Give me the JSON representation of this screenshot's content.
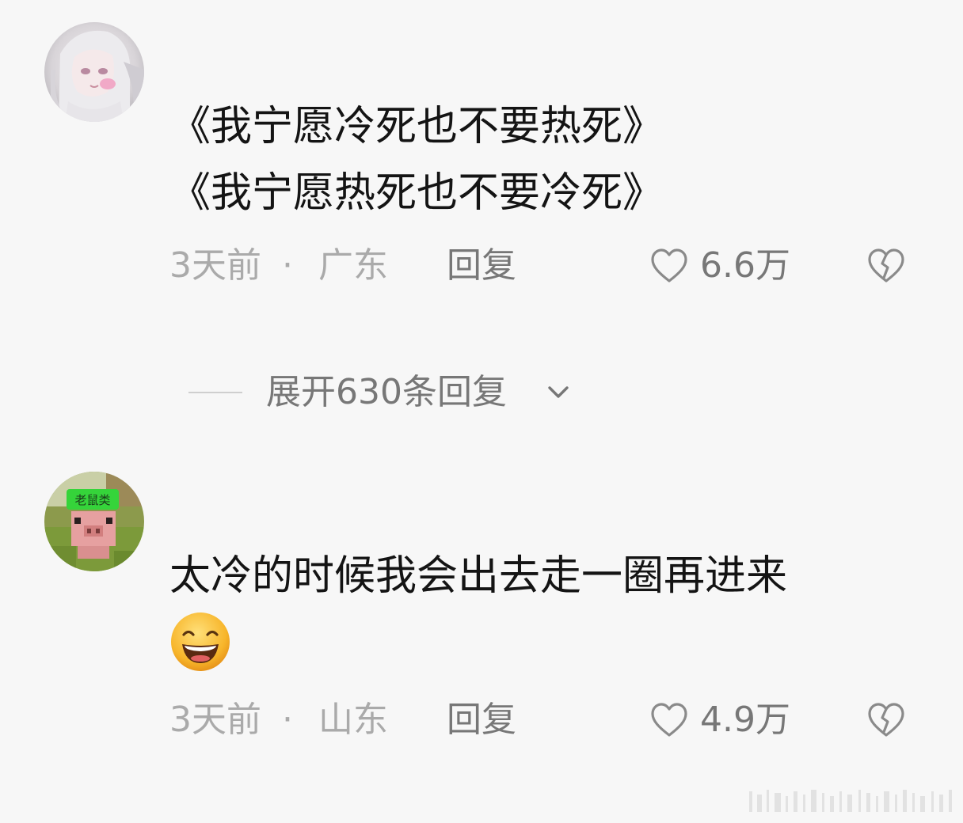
{
  "comments": [
    {
      "avatar_icon": "anime-girl-avatar",
      "text_lines": [
        "《我宁愿冷死也不要热死》",
        "《我宁愿热死也不要冷死》"
      ],
      "time": "3天前",
      "separator": "·",
      "location": "广东",
      "reply_label": "回复",
      "like_count": "6.6万"
    },
    {
      "avatar_icon": "pixel-pig-avatar",
      "avatar_badge": "老鼠类",
      "text_lines": [
        "太冷的时候我会出去走一圈再进来"
      ],
      "emoji": "grinning-squinting-face-emoji",
      "time": "3天前",
      "separator": "·",
      "location": "山东",
      "reply_label": "回复",
      "like_count": "4.9万"
    }
  ],
  "expand_replies": {
    "label": "展开630条回复"
  },
  "colors": {
    "background": "#f7f7f7",
    "text_primary": "#141414",
    "text_meta": "#aaaaaa",
    "text_secondary": "#777777"
  }
}
